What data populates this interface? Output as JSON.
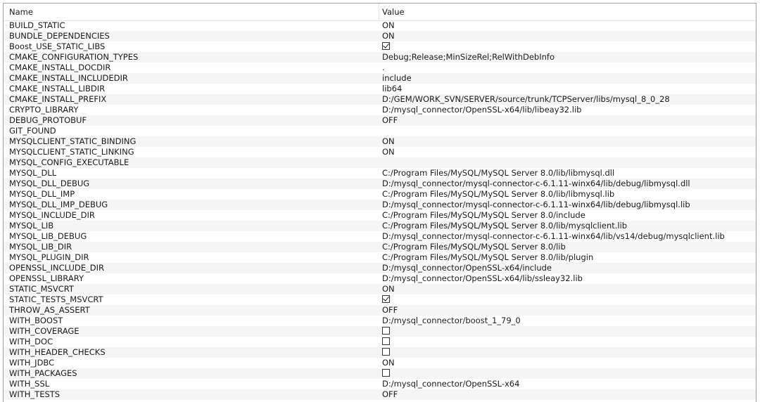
{
  "table": {
    "headers": {
      "name": "Name",
      "value": "Value"
    },
    "rows": [
      {
        "name": "BUILD_STATIC",
        "value": "ON",
        "kind": "text"
      },
      {
        "name": "BUNDLE_DEPENDENCIES",
        "value": "ON",
        "kind": "text"
      },
      {
        "name": "Boost_USE_STATIC_LIBS",
        "value": "",
        "kind": "checkbox",
        "checked": true
      },
      {
        "name": "CMAKE_CONFIGURATION_TYPES",
        "value": "Debug;Release;MinSizeRel;RelWithDebInfo",
        "kind": "text"
      },
      {
        "name": "CMAKE_INSTALL_DOCDIR",
        "value": ".",
        "kind": "text"
      },
      {
        "name": "CMAKE_INSTALL_INCLUDEDIR",
        "value": "include",
        "kind": "text"
      },
      {
        "name": "CMAKE_INSTALL_LIBDIR",
        "value": "lib64",
        "kind": "text"
      },
      {
        "name": "CMAKE_INSTALL_PREFIX",
        "value": "D:/GEM/WORK_SVN/SERVER/source/trunk/TCPServer/libs/mysql_8_0_28",
        "kind": "text"
      },
      {
        "name": "CRYPTO_LIBRARY",
        "value": "D:/mysql_connector/OpenSSL-x64/lib/libeay32.lib",
        "kind": "text"
      },
      {
        "name": "DEBUG_PROTOBUF",
        "value": "OFF",
        "kind": "text"
      },
      {
        "name": "GIT_FOUND",
        "value": "",
        "kind": "text"
      },
      {
        "name": "MYSQLCLIENT_STATIC_BINDING",
        "value": "ON",
        "kind": "text"
      },
      {
        "name": "MYSQLCLIENT_STATIC_LINKING",
        "value": "ON",
        "kind": "text"
      },
      {
        "name": "MYSQL_CONFIG_EXECUTABLE",
        "value": "",
        "kind": "text"
      },
      {
        "name": "MYSQL_DLL",
        "value": "C:/Program Files/MySQL/MySQL Server 8.0/lib/libmysql.dll",
        "kind": "text"
      },
      {
        "name": "MYSQL_DLL_DEBUG",
        "value": "D:/mysql_connector/mysql-connector-c-6.1.11-winx64/lib/debug/libmysql.dll",
        "kind": "text"
      },
      {
        "name": "MYSQL_DLL_IMP",
        "value": "C:/Program Files/MySQL/MySQL Server 8.0/lib/libmysql.lib",
        "kind": "text"
      },
      {
        "name": "MYSQL_DLL_IMP_DEBUG",
        "value": "D:/mysql_connector/mysql-connector-c-6.1.11-winx64/lib/debug/libmysql.lib",
        "kind": "text"
      },
      {
        "name": "MYSQL_INCLUDE_DIR",
        "value": "C:/Program Files/MySQL/MySQL Server 8.0/include",
        "kind": "text"
      },
      {
        "name": "MYSQL_LIB",
        "value": "C:/Program Files/MySQL/MySQL Server 8.0/lib/mysqlclient.lib",
        "kind": "text"
      },
      {
        "name": "MYSQL_LIB_DEBUG",
        "value": "D:/mysql_connector/mysql-connector-c-6.1.11-winx64/lib/vs14/debug/mysqlclient.lib",
        "kind": "text"
      },
      {
        "name": "MYSQL_LIB_DIR",
        "value": "C:/Program Files/MySQL/MySQL Server 8.0/lib",
        "kind": "text"
      },
      {
        "name": "MYSQL_PLUGIN_DIR",
        "value": "C:/Program Files/MySQL/MySQL Server 8.0/lib/plugin",
        "kind": "text"
      },
      {
        "name": "OPENSSL_INCLUDE_DIR",
        "value": "D:/mysql_connector/OpenSSL-x64/include",
        "kind": "text"
      },
      {
        "name": "OPENSSL_LIBRARY",
        "value": "D:/mysql_connector/OpenSSL-x64/lib/ssleay32.lib",
        "kind": "text"
      },
      {
        "name": "STATIC_MSVCRT",
        "value": "ON",
        "kind": "text"
      },
      {
        "name": "STATIC_TESTS_MSVCRT",
        "value": "",
        "kind": "checkbox",
        "checked": true
      },
      {
        "name": "THROW_AS_ASSERT",
        "value": "OFF",
        "kind": "text"
      },
      {
        "name": "WITH_BOOST",
        "value": "D:/mysql_connector/boost_1_79_0",
        "kind": "text"
      },
      {
        "name": "WITH_COVERAGE",
        "value": "",
        "kind": "checkbox",
        "checked": false
      },
      {
        "name": "WITH_DOC",
        "value": "",
        "kind": "checkbox",
        "checked": false
      },
      {
        "name": "WITH_HEADER_CHECKS",
        "value": "",
        "kind": "checkbox",
        "checked": false
      },
      {
        "name": "WITH_JDBC",
        "value": "ON",
        "kind": "text"
      },
      {
        "name": "WITH_PACKAGES",
        "value": "",
        "kind": "checkbox",
        "checked": false
      },
      {
        "name": "WITH_SSL",
        "value": "D:/mysql_connector/OpenSSL-x64",
        "kind": "text"
      },
      {
        "name": "WITH_TESTS",
        "value": "OFF",
        "kind": "text"
      }
    ]
  }
}
